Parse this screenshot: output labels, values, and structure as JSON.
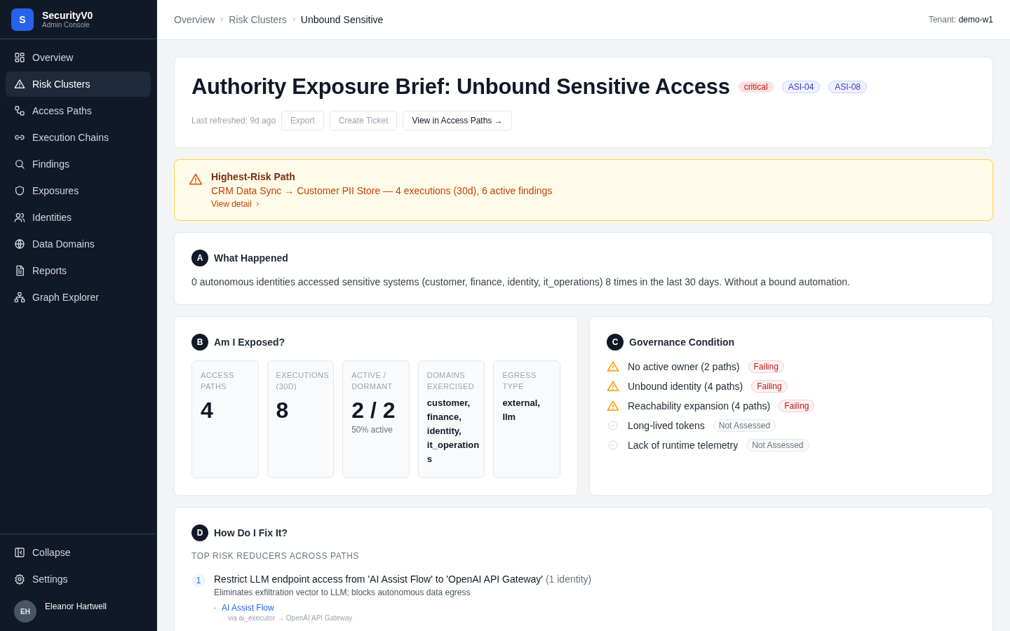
{
  "brand": {
    "logo": "S",
    "name": "SecurityV0",
    "subtitle": "Admin Console"
  },
  "nav": [
    {
      "label": "Overview",
      "selected": false
    },
    {
      "label": "Risk Clusters",
      "selected": true
    },
    {
      "label": "Access Paths",
      "selected": false
    },
    {
      "label": "Execution Chains",
      "selected": false
    },
    {
      "label": "Findings",
      "selected": false
    },
    {
      "label": "Exposures",
      "selected": false
    },
    {
      "label": "Identities",
      "selected": false
    },
    {
      "label": "Data Domains",
      "selected": false
    },
    {
      "label": "Reports",
      "selected": false
    },
    {
      "label": "Graph Explorer",
      "selected": false
    }
  ],
  "sidebar_footer": {
    "collapse": "Collapse",
    "settings": "Settings",
    "user": {
      "initials": "EH",
      "name": "Eleanor Hartwell"
    }
  },
  "breadcrumbs": [
    {
      "label": "Overview",
      "selected": false
    },
    {
      "label": "Risk Clusters",
      "selected": false
    },
    {
      "label": "Unbound Sensitive",
      "selected": true
    }
  ],
  "tenant": {
    "label": "Tenant:",
    "value": "demo-w1"
  },
  "brief": {
    "title": "Authority Exposure Brief: Unbound Sensitive Access",
    "badges": [
      {
        "label": "critical",
        "kind": "severity"
      },
      {
        "label": "ASI-04",
        "kind": "standard"
      },
      {
        "label": "ASI-08",
        "kind": "standard"
      }
    ],
    "refreshed": "Last refreshed: 9d ago",
    "actions": [
      {
        "label": "Export",
        "disabled": true
      },
      {
        "label": "Create Ticket",
        "disabled": true
      },
      {
        "label": "View in Access Paths →",
        "disabled": false
      }
    ]
  },
  "alert": {
    "title": "Highest-Risk Path",
    "text": "CRM Data Sync → Customer PII Store — 4 executions (30d), 6 active findings",
    "link": "View detail"
  },
  "what_happened": {
    "letter": "A",
    "title": "What Happened",
    "text": "0 autonomous identities accessed sensitive systems (customer, finance, identity, it_operations) 8 times in the last 30 days. Without a bound automation."
  },
  "exposed": {
    "letter": "B",
    "title": "Am I Exposed?",
    "stats": [
      {
        "label": "ACCESS PATHS",
        "value": "4",
        "kind": "number"
      },
      {
        "label": "EXECUTIONS (30D)",
        "value": "8",
        "kind": "number"
      },
      {
        "label": "ACTIVE / DORMANT",
        "value": "2 / 2",
        "sub": "50% active",
        "kind": "number"
      },
      {
        "label": "DOMAINS EXERCISED",
        "value": "customer, finance, identity, it_operations",
        "kind": "list"
      },
      {
        "label": "EGRESS TYPE",
        "value": "external, llm",
        "kind": "list"
      }
    ]
  },
  "governance": {
    "letter": "C",
    "title": "Governance Condition",
    "conditions": [
      {
        "label": "No active owner (2 paths)",
        "status": "Failing",
        "kind": "failing"
      },
      {
        "label": "Unbound identity (4 paths)",
        "status": "Failing",
        "kind": "failing"
      },
      {
        "label": "Reachability expansion (4 paths)",
        "status": "Failing",
        "kind": "failing"
      },
      {
        "label": "Long-lived tokens",
        "status": "Not Assessed",
        "kind": "not_assessed"
      },
      {
        "label": "Lack of runtime telemetry",
        "status": "Not Assessed",
        "kind": "not_assessed"
      }
    ]
  },
  "fix": {
    "letter": "D",
    "title": "How Do I Fix It?",
    "subtitle": "TOP RISK REDUCERS ACROSS PATHS",
    "items": [
      {
        "rank": "1",
        "title": "Restrict LLM endpoint access from 'AI Assist Flow' to 'OpenAI API Gateway'",
        "count": "(1 identity)",
        "description": "Eliminates exfiltration vector to LLM; blocks autonomous data egress",
        "targets": [
          {
            "link": "AI Assist Flow",
            "via": "via ai_executor → OpenAI API Gateway"
          }
        ]
      }
    ]
  }
}
